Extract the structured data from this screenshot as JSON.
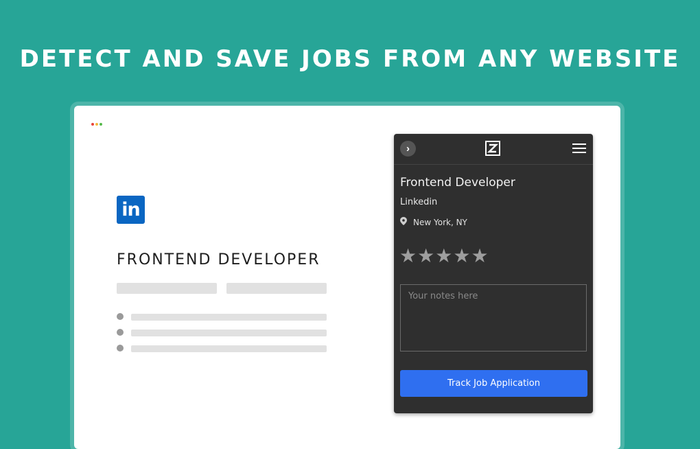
{
  "headline": "DETECT AND SAVE JOBS FROM ANY WEBSITE",
  "colors": {
    "background": "#27a597",
    "linkedin_blue": "#0a66c2",
    "panel_bg": "#2f2f2f",
    "primary_button": "#2f6ff0",
    "window_dots": [
      "#e8453c",
      "#f5b83d",
      "#55b94b"
    ]
  },
  "page": {
    "logo_icon": "linkedin-logo",
    "logo_text": "in",
    "job_title": "FRONTEND DEVELOPER"
  },
  "panel": {
    "collapse_icon": "chevron-right",
    "brand_icon": "z-logo",
    "menu_icon": "hamburger",
    "job_title": "Frontend Developer",
    "company": "Linkedin",
    "location_icon": "map-pin",
    "location": "New York, NY",
    "rating": {
      "value": 0,
      "max": 5
    },
    "notes_placeholder": "Your notes here",
    "track_button": "Track Job Application"
  }
}
